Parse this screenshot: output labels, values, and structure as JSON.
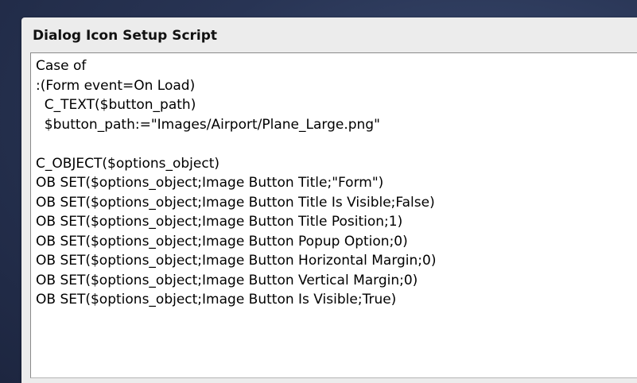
{
  "panel": {
    "title": "Dialog Icon Setup Script"
  },
  "editor": {
    "lines": [
      "Case of",
      ":(Form event=On Load)",
      "  C_TEXT($button_path)",
      "  $button_path:=\"Images/Airport/Plane_Large.png\"",
      "",
      "C_OBJECT($options_object)",
      "OB SET($options_object;Image Button Title;\"Form\")",
      "OB SET($options_object;Image Button Title Is Visible;False)",
      "OB SET($options_object;Image Button Title Position;1)",
      "OB SET($options_object;Image Button Popup Option;0)",
      "OB SET($options_object;Image Button Horizontal Margin;0)",
      "OB SET($options_object;Image Button Vertical Margin;0)",
      "OB SET($options_object;Image Button Is Visible;True)"
    ]
  }
}
